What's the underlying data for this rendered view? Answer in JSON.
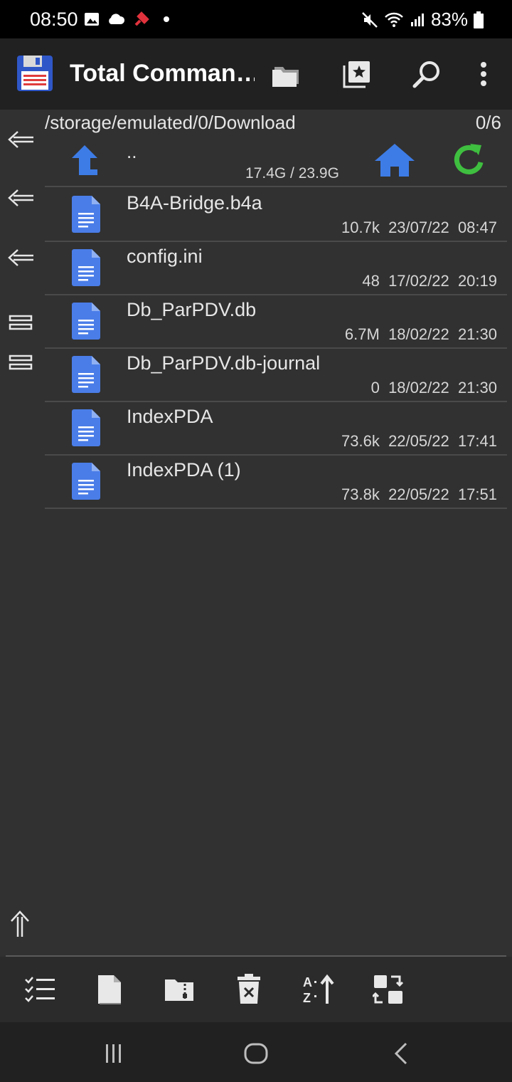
{
  "status_bar": {
    "time": "08:50",
    "battery": "83%",
    "icons_left": [
      "image-icon",
      "cloud-icon",
      "pin-icon",
      "dot-icon"
    ],
    "icons_right": [
      "mute-icon",
      "wifi-icon",
      "signal-icon",
      "battery-icon"
    ]
  },
  "app_bar": {
    "title": "Total Comman…",
    "actions": [
      "folder-icon",
      "bookmark-icon",
      "search-icon",
      "more-icon"
    ]
  },
  "path": {
    "current": "/storage/emulated/0/Download",
    "count": "0/6"
  },
  "parent": {
    "label": "..",
    "space": "17.4G / 23.9G"
  },
  "files": [
    {
      "name": "B4A-Bridge.b4a",
      "size": "10.7k",
      "date": "23/07/22",
      "time": "08:47"
    },
    {
      "name": "config.ini",
      "size": "48",
      "date": "17/02/22",
      "time": "20:19"
    },
    {
      "name": "Db_ParPDV.db",
      "size": "6.7M",
      "date": "18/02/22",
      "time": "21:30"
    },
    {
      "name": "Db_ParPDV.db-journal",
      "size": "0",
      "date": "18/02/22",
      "time": "21:30"
    },
    {
      "name": "IndexPDA",
      "size": "73.6k",
      "date": "22/05/22",
      "time": "17:41"
    },
    {
      "name": "IndexPDA (1)",
      "size": "73.8k",
      "date": "22/05/22",
      "time": "17:51"
    }
  ],
  "colors": {
    "background": "#313131",
    "app_bar": "#212121",
    "file_icon": "#4a7de8",
    "reload": "#3fbf3f",
    "home": "#3d7ce6"
  },
  "toolbar": [
    "select-icon",
    "new-file-icon",
    "zip-folder-icon",
    "delete-icon",
    "sort-icon",
    "swap-icon"
  ],
  "navbar": [
    "recents-icon",
    "home-icon",
    "back-icon"
  ]
}
